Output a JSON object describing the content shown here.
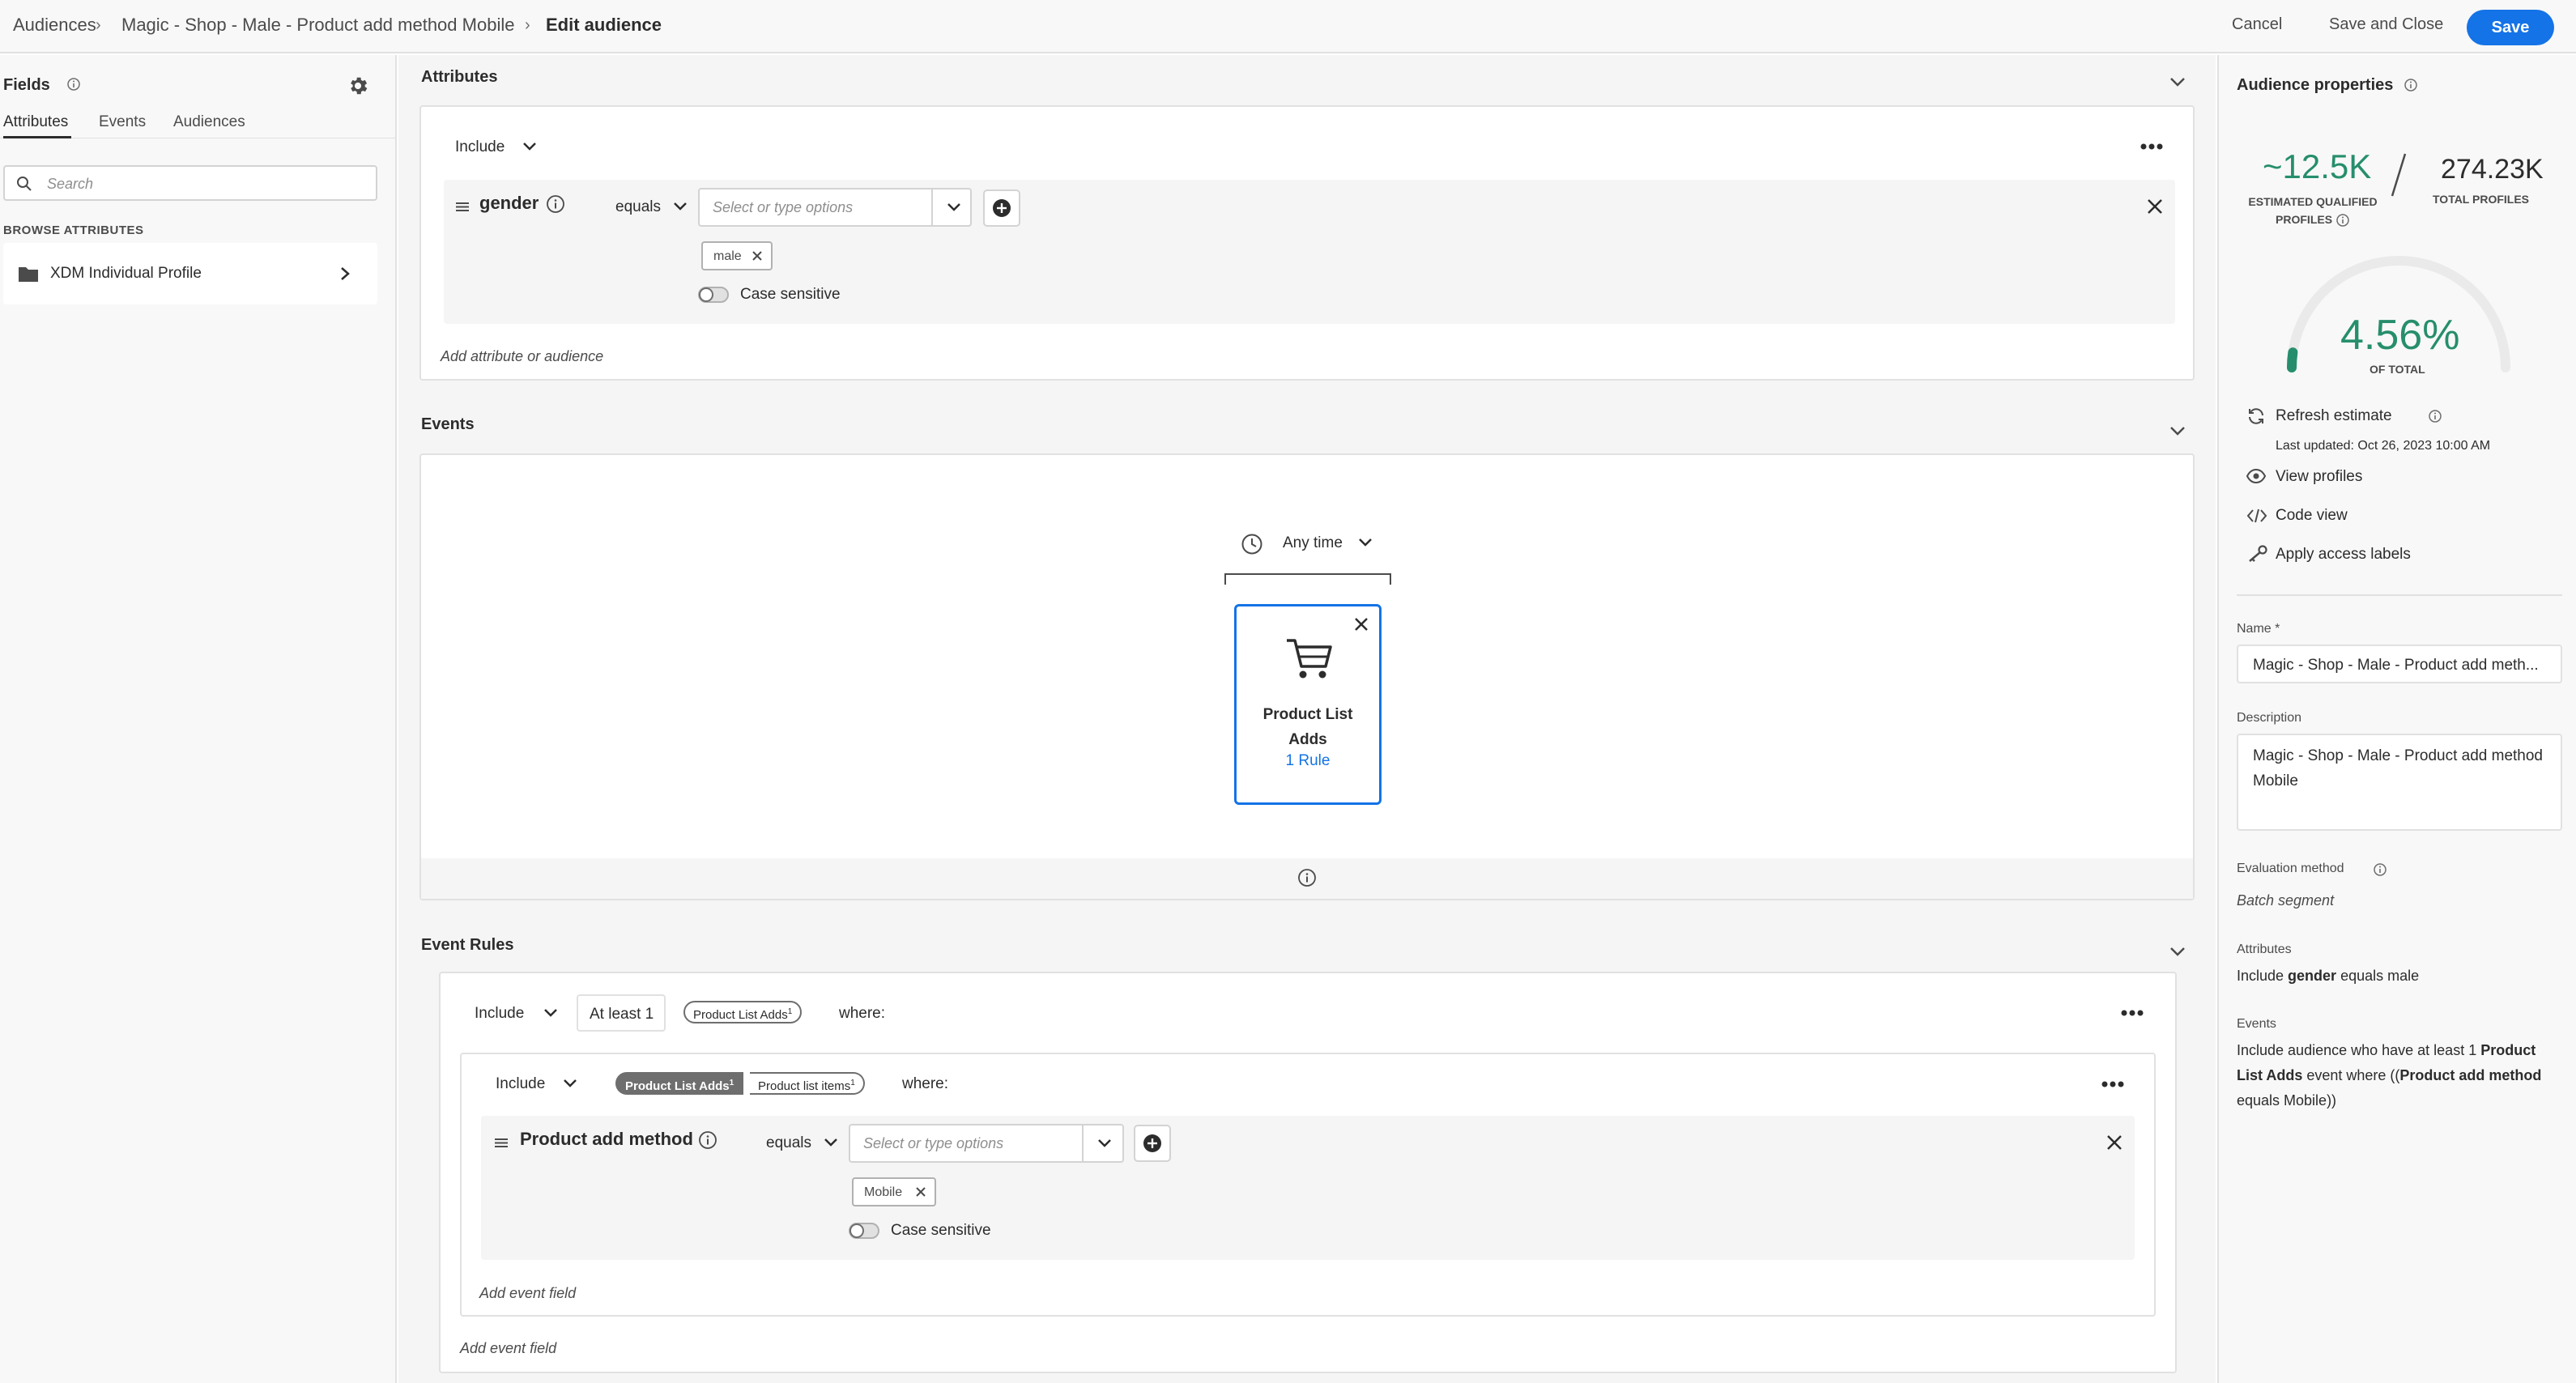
{
  "breadcrumb": {
    "items": [
      "Audiences",
      "Magic - Shop - Male - Product add method Mobile"
    ],
    "current": "Edit audience"
  },
  "actions": {
    "cancel": "Cancel",
    "save_close": "Save and Close",
    "save": "Save"
  },
  "fields_panel": {
    "title": "Fields",
    "tabs": [
      "Attributes",
      "Events",
      "Audiences"
    ],
    "active_tab": "Attributes",
    "search_placeholder": "Search",
    "browse_heading": "BROWSE ATTRIBUTES",
    "browse_items": [
      {
        "label": "XDM Individual Profile",
        "icon": "folder-icon"
      }
    ]
  },
  "attributes_section": {
    "title": "Attributes",
    "include": "Include",
    "rule": {
      "field": "gender",
      "operator": "equals",
      "placeholder": "Select or type options",
      "tag": "male",
      "case_sensitive": "Case sensitive"
    },
    "add_link": "Add attribute or audience"
  },
  "events_section": {
    "title": "Events",
    "time": "Any time",
    "event_card": {
      "title_line1": "Product List",
      "title_line2": "Adds",
      "rules": "1 Rule",
      "icon": "cart-icon"
    }
  },
  "event_rules_section": {
    "title": "Event Rules",
    "outer": {
      "include": "Include",
      "count": "At least 1",
      "event_pill": "Product List Adds",
      "event_pill_sup": "1",
      "where": "where:"
    },
    "inner": {
      "include": "Include",
      "pills": [
        {
          "label": "Product List Adds",
          "sup": "1",
          "active": true
        },
        {
          "label": "Product list items",
          "sup": "1",
          "active": false
        }
      ],
      "where": "where:",
      "rule": {
        "field": "Product add method",
        "operator": "equals",
        "placeholder": "Select or type options",
        "tag": "Mobile",
        "case_sensitive": "Case sensitive"
      },
      "add_link": "Add event field"
    },
    "outer_add_link": "Add event field"
  },
  "audience_properties": {
    "title": "Audience properties",
    "qualified_value": "~12.5K",
    "qualified_label_1": "ESTIMATED QUALIFIED",
    "qualified_label_2": "PROFILES",
    "total_value": "274.23K",
    "total_label": "TOTAL PROFILES",
    "percent": "4.56%",
    "percent_label": "OF TOTAL",
    "percent_fraction": 0.0456,
    "refresh": "Refresh estimate",
    "last_updated": "Last updated: Oct 26, 2023 10:00 AM",
    "links": [
      {
        "label": "View profiles",
        "icon": "eye-icon"
      },
      {
        "label": "Code view",
        "icon": "code-icon"
      },
      {
        "label": "Apply access labels",
        "icon": "key-icon"
      }
    ],
    "name_label": "Name *",
    "name_value": "Magic - Shop - Male - Product add meth...",
    "description_label": "Description",
    "description_value": "Magic - Shop - Male - Product add method Mobile",
    "evaluation_label": "Evaluation method",
    "evaluation_value": "Batch segment",
    "attributes_label": "Attributes",
    "attributes_summary": {
      "pre": "Include ",
      "bold": "gender",
      "post": " equals male"
    },
    "events_label": "Events",
    "events_summary": {
      "p1": "Include audience who have at least 1 ",
      "b1": "Product List Adds",
      "p2": " event where ((",
      "b2": "Product add method",
      "p3": " equals Mobile))"
    }
  },
  "colors": {
    "accent": "#1473e6",
    "positive": "#268e6c",
    "text": "#2c2c2c"
  }
}
